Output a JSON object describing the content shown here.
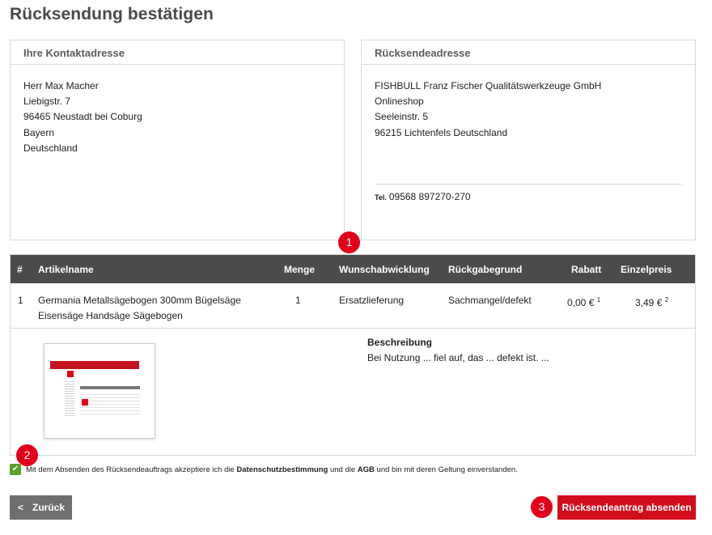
{
  "page": {
    "title": "Rücksendung bestätigen"
  },
  "contact_address": {
    "heading": "Ihre Kontaktadresse",
    "lines": [
      "Herr Max Macher",
      "Liebigstr. 7",
      "96465 Neustadt bei Coburg",
      "Bayern",
      "Deutschland"
    ]
  },
  "return_address": {
    "heading": "Rücksendeadresse",
    "lines": [
      "FISHBULL Franz Fischer Qualitätswerkzeuge GmbH",
      "Onlineshop",
      "Seeleinstr. 5",
      "96215 Lichtenfels Deutschland"
    ],
    "tel_label": "Tel.",
    "tel": "09568 897270-270"
  },
  "badges": [
    "1",
    "2",
    "3"
  ],
  "table": {
    "headers": [
      "#",
      "Artikelname",
      "Menge",
      "Wunschabwicklung",
      "Rückgabegrund",
      "Rabatt",
      "Einzelpreis"
    ],
    "rows": [
      {
        "num": "1",
        "name_line1": "Germania Metallsägebogen 300mm Bügelsäge",
        "name_line2": "Eisensäge Handsäge Sägebogen",
        "qty": "1",
        "handling": "Ersatzlieferung",
        "reason": "Sachmangel/defekt",
        "discount": "0,00 €",
        "discount_note": "1",
        "price": "3,49 €",
        "price_note": "2"
      }
    ],
    "description_label": "Beschreibung",
    "description": "Bei Nutzung ... fiel auf, das ... defekt ist. ..."
  },
  "consent": {
    "text_1": "Mit dem Absenden des Rücksendeauftrags akzeptiere ich die ",
    "link_1": "Datenschutzbestimmung",
    "text_2": " und die ",
    "link_2": "AGB",
    "text_3": " und bin mit deren Geltung einverstanden.",
    "checked": true
  },
  "buttons": {
    "back": "Zurück",
    "submit": "Rücksendeantrag absenden"
  },
  "colors": {
    "accent": "#d10d1e",
    "badge": "#e2001a",
    "table_header": "#4b4b4b",
    "checkbox": "#5aa02c",
    "back_button": "#6f6f6f"
  }
}
